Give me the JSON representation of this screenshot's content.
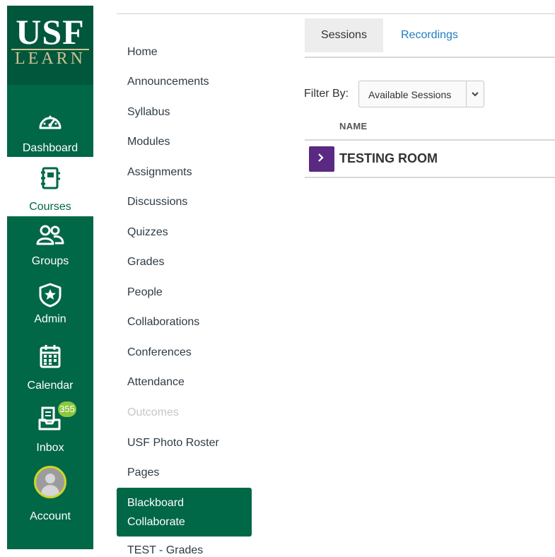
{
  "logo": {
    "top": "USF",
    "bottom": "LEARN"
  },
  "global_nav": {
    "dashboard": "Dashboard",
    "courses": "Courses",
    "groups": "Groups",
    "admin": "Admin",
    "calendar": "Calendar",
    "inbox": "Inbox",
    "inbox_count": "355",
    "account": "Account"
  },
  "course_nav": {
    "items": [
      "Home",
      "Announcements",
      "Syllabus",
      "Modules",
      "Assignments",
      "Discussions",
      "Quizzes",
      "Grades",
      "People",
      "Collaborations",
      "Conferences",
      "Attendance",
      "Outcomes",
      "USF Photo Roster",
      "Pages"
    ],
    "active_line1": "Blackboard",
    "active_line2": "Collaborate",
    "next_partial": "TEST - Grades"
  },
  "tabs": {
    "sessions": "Sessions",
    "recordings": "Recordings"
  },
  "filter": {
    "label": "Filter By:",
    "value": "Available Sessions"
  },
  "table": {
    "header": "NAME",
    "rows": [
      {
        "name": "TESTING ROOM"
      }
    ]
  },
  "colors": {
    "nav_green": "#006747",
    "session_purple": "#5a2a82",
    "link_blue": "#1f7fc1",
    "badge_green": "#8dc63f"
  }
}
